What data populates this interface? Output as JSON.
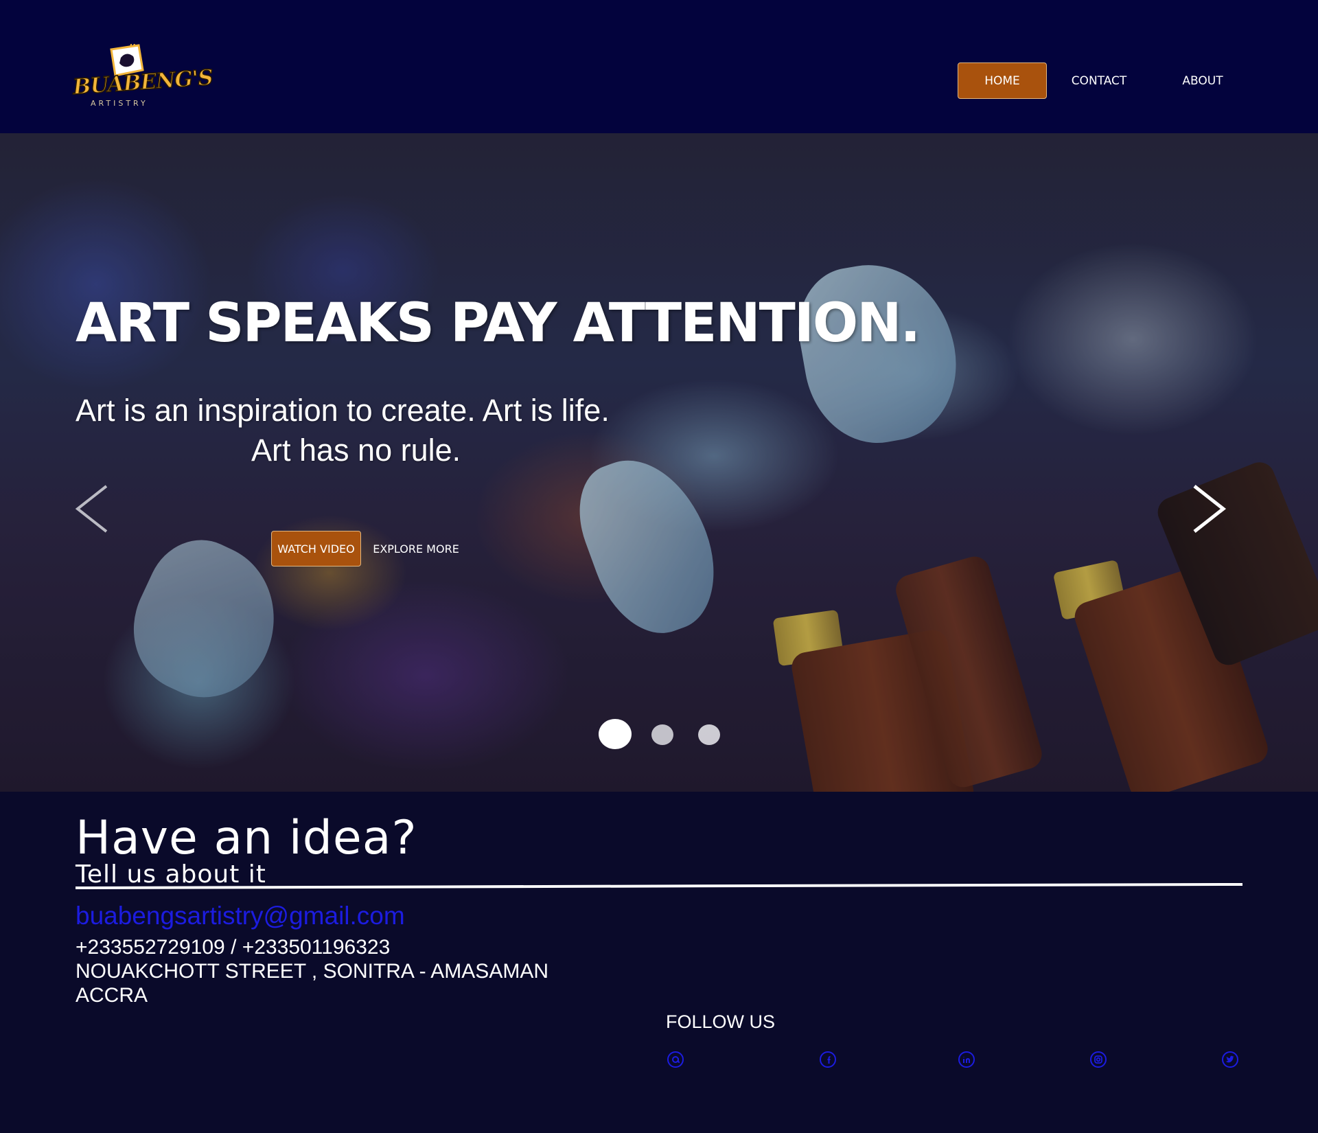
{
  "brand": {
    "logo_name": "BUABENG'S",
    "logo_tagline": "ARTISTRY"
  },
  "nav": {
    "items": [
      {
        "label": "HOME",
        "active": true
      },
      {
        "label": "CONTACT",
        "active": false
      },
      {
        "label": "ABOUT",
        "active": false
      }
    ]
  },
  "hero": {
    "title": "ART SPEAKS PAY ATTENTION.",
    "subtitle_line1": "Art is an inspiration to create. Art is life.",
    "subtitle_line2": "Art has no rule.",
    "watch_label": "WATCH VIDEO",
    "explore_label": "EXPLORE MORE",
    "prev_icon": "chevron-left-icon",
    "next_icon": "chevron-right-icon",
    "slides_total": 3,
    "active_slide": 1
  },
  "footer": {
    "heading": "Have an idea?",
    "subheading": "Tell us about it",
    "email": "buabengsartistry@gmail.com",
    "phone": "+233552729109 / +233501196323",
    "street": "NOUAKCHOTT STREET , SONITRA - AMASAMAN",
    "city": "ACCRA",
    "follow_label": "FOLLOW US",
    "social_icons": [
      "email-icon",
      "facebook-icon",
      "linkedin-icon",
      "instagram-icon",
      "twitter-icon"
    ]
  },
  "colors": {
    "header_bg": "#03033d",
    "footer_bg": "#0a0a2a",
    "accent": "#a9520d",
    "link": "#1c1ce0",
    "logo_gold": "#f2b53a"
  }
}
